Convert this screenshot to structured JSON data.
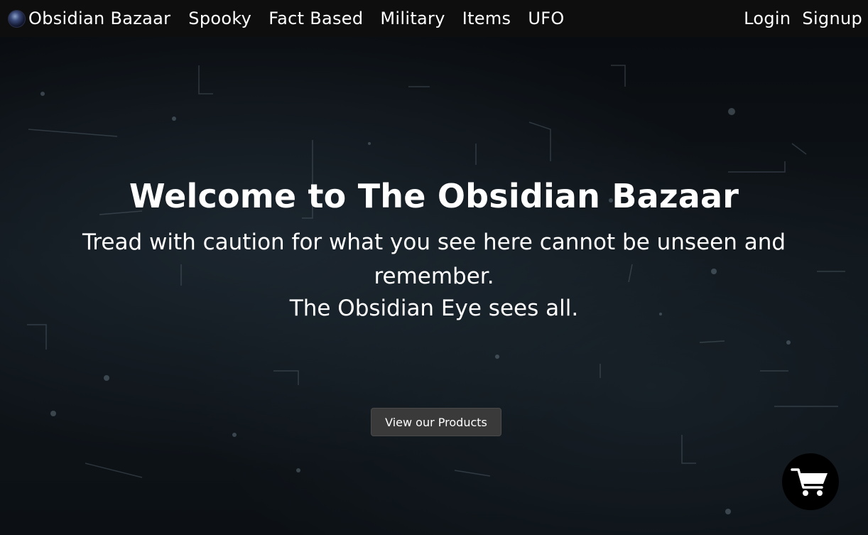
{
  "navbar": {
    "brand": {
      "label": "Obsidian Bazaar",
      "icon": "obsidian-orb-icon"
    },
    "links": [
      {
        "label": "Spooky"
      },
      {
        "label": "Fact Based"
      },
      {
        "label": "Military"
      },
      {
        "label": "Items"
      },
      {
        "label": "UFO"
      }
    ],
    "auth": {
      "login": "Login",
      "signup": "Signup"
    }
  },
  "hero": {
    "title": "Welcome to The Obsidian Bazaar",
    "subtitle": "Tread with caution for what you see here cannot be unseen and remember.",
    "subtitle2": "The Obsidian Eye sees all.",
    "cta_label": "View our Products"
  },
  "cart": {
    "icon": "shopping-cart-icon"
  },
  "colors": {
    "navbar_bg": "#0e0e0e",
    "hero_bg": "#10161c",
    "button_bg": "#3a3a3a",
    "text": "#ffffff"
  }
}
